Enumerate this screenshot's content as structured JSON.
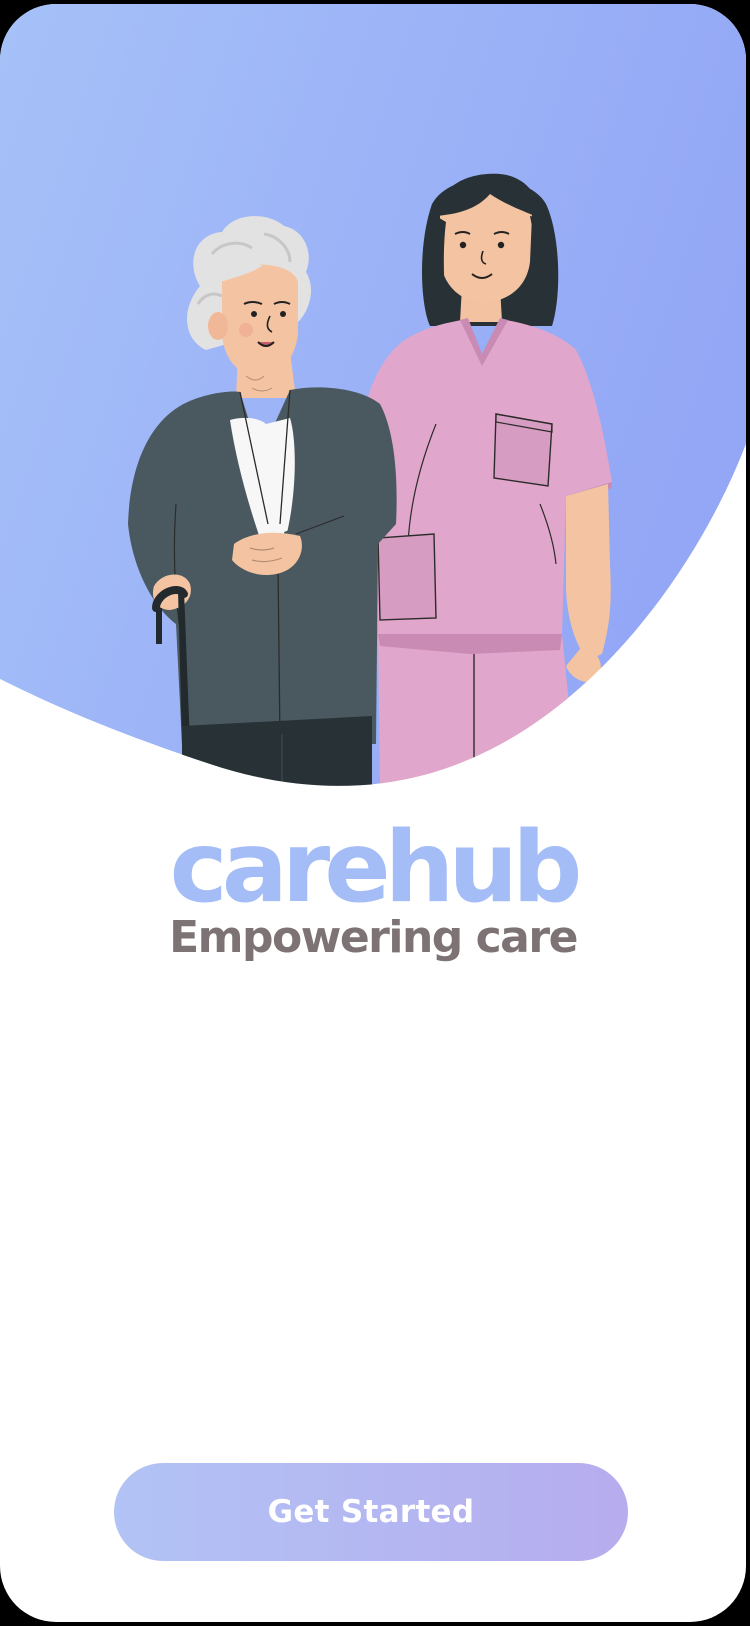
{
  "app": {
    "brand_name": "carehub",
    "tagline": "Empowering care"
  },
  "hero": {
    "illustration": "elderly-woman-with-cane-and-nurse",
    "gradient_start": "#a6c1f8",
    "gradient_end": "#93a7f6"
  },
  "actions": {
    "get_started_label": "Get Started"
  },
  "colors": {
    "brand": "#a5bdf7",
    "tagline": "#7d7374",
    "button_start": "#b2c3f5",
    "button_end": "#b6acee",
    "button_text": "#ffffff"
  }
}
